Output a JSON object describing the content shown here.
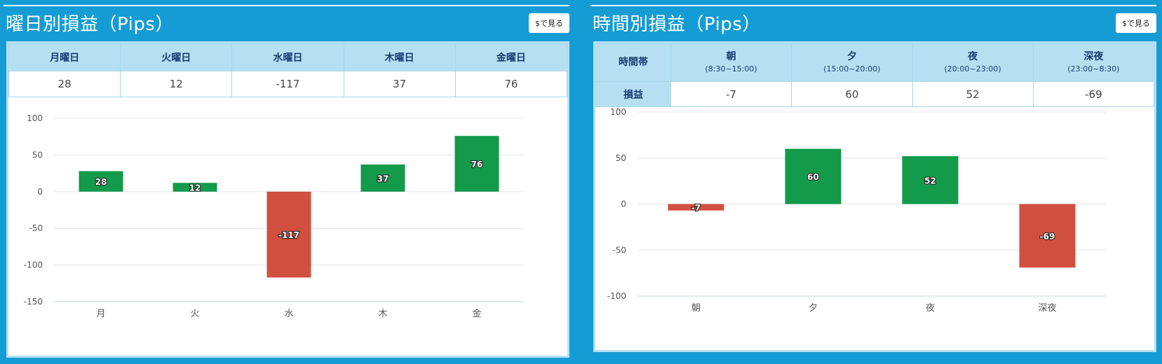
{
  "left": {
    "title": "曜日別損益（Pips）",
    "button_label": "$で見る",
    "headers": [
      "月曜日",
      "火曜日",
      "水曜日",
      "木曜日",
      "金曜日"
    ],
    "values": [
      "28",
      "12",
      "-117",
      "37",
      "76"
    ]
  },
  "right": {
    "title": "時間別損益（Pips）",
    "button_label": "$で見る",
    "row_header": "時間帯",
    "row_label": "損益",
    "columns": [
      {
        "name": "朝",
        "range": "(8:30~15:00)"
      },
      {
        "name": "夕",
        "range": "(15:00~20:00)"
      },
      {
        "name": "夜",
        "range": "(20:00~23:00)"
      },
      {
        "name": "深夜",
        "range": "(23:00~8:30)"
      }
    ],
    "values": [
      "-7",
      "60",
      "52",
      "-69"
    ]
  },
  "colors": {
    "positive": "#139a4b",
    "negative": "#d14f3e",
    "background": "#159cd4",
    "header": "#b6e0f2"
  },
  "chart_data": [
    {
      "type": "bar",
      "categories": [
        "月",
        "火",
        "水",
        "木",
        "金"
      ],
      "values": [
        28,
        12,
        -117,
        37,
        76
      ],
      "ylim": [
        -150,
        100
      ],
      "yticks": [
        100,
        50,
        0,
        -50,
        -100,
        -150
      ],
      "grid": true,
      "legend": "none"
    },
    {
      "type": "bar",
      "categories": [
        "朝",
        "夕",
        "夜",
        "深夜"
      ],
      "values": [
        -7,
        60,
        52,
        -69
      ],
      "ylim": [
        -100,
        100
      ],
      "yticks": [
        100,
        50,
        0,
        -50,
        -100
      ],
      "grid": true,
      "legend": "none"
    }
  ]
}
